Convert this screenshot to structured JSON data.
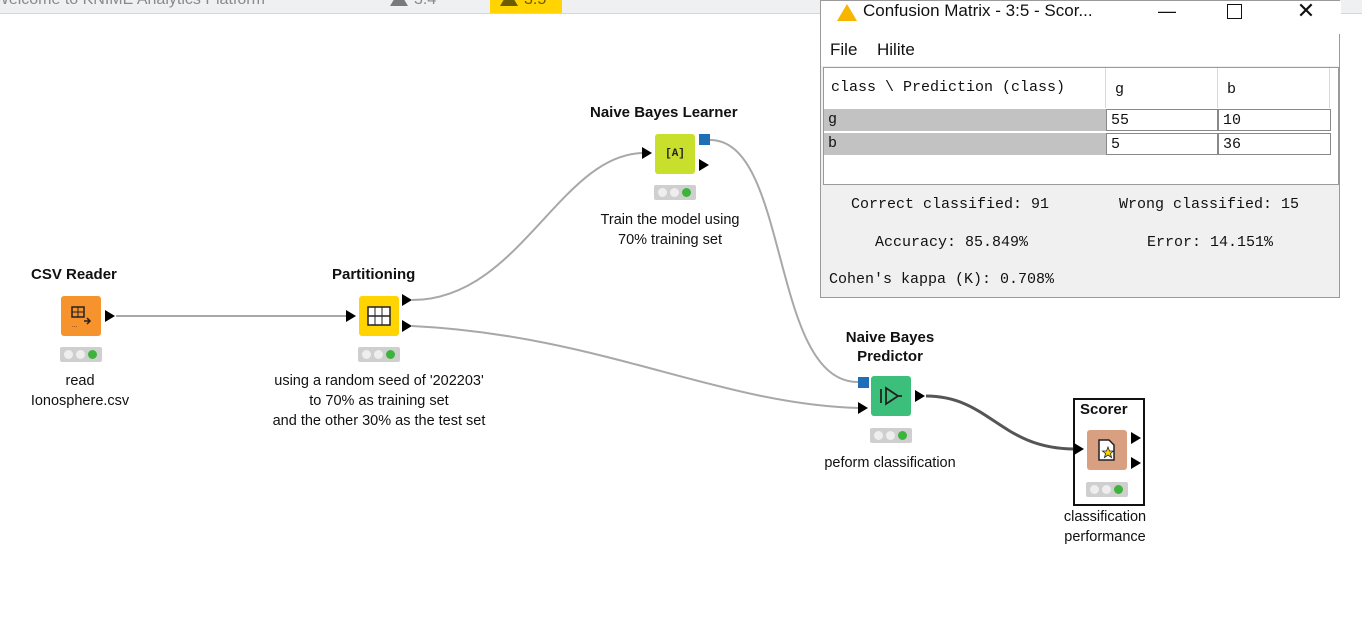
{
  "tabs": [
    {
      "label": "Welcome to KNIME Analytics Platform",
      "active": false
    },
    {
      "label": "3:4",
      "active": false
    },
    {
      "label": "3:5*",
      "active": true
    }
  ],
  "nodes": {
    "csv_reader": {
      "title": "CSV Reader",
      "desc_line1": "read",
      "desc_line2": "Ionosphere.csv",
      "color": "#f7932d"
    },
    "partitioning": {
      "title": "Partitioning",
      "desc_line1": "using a random seed of '202203'",
      "desc_line2": "to 70% as training set",
      "desc_line3": "and the other 30% as the test set",
      "color": "#ffd400"
    },
    "learner": {
      "title": "Naive Bayes Learner",
      "desc_line1": "Train the model using",
      "desc_line2": "70% training set",
      "color": "#c8df2c",
      "glyph": "[A]"
    },
    "predictor": {
      "title_line1": "Naive Bayes",
      "title_line2": "Predictor",
      "desc_line1": "peform classification",
      "color": "#3cbf7a"
    },
    "scorer": {
      "title": "Scorer",
      "desc_line1": "classification",
      "desc_line2": "performance",
      "color": "#d8a080"
    }
  },
  "dialog": {
    "title": "Confusion Matrix - 3:5 - Scor...",
    "menu": {
      "file": "File",
      "hilite": "Hilite"
    },
    "table": {
      "corner": "class \\ Prediction (class)",
      "columns": [
        "g",
        "b"
      ],
      "rows": [
        {
          "label": "g",
          "values": [
            "55",
            "10"
          ]
        },
        {
          "label": "b",
          "values": [
            "5",
            "36"
          ]
        }
      ]
    },
    "correct": "Correct classified: 91",
    "wrong": "Wrong classified: 15",
    "accuracy": "Accuracy: 85.849%",
    "error": "Error: 14.151%",
    "kappa": "Cohen's kappa (K): 0.708%"
  }
}
